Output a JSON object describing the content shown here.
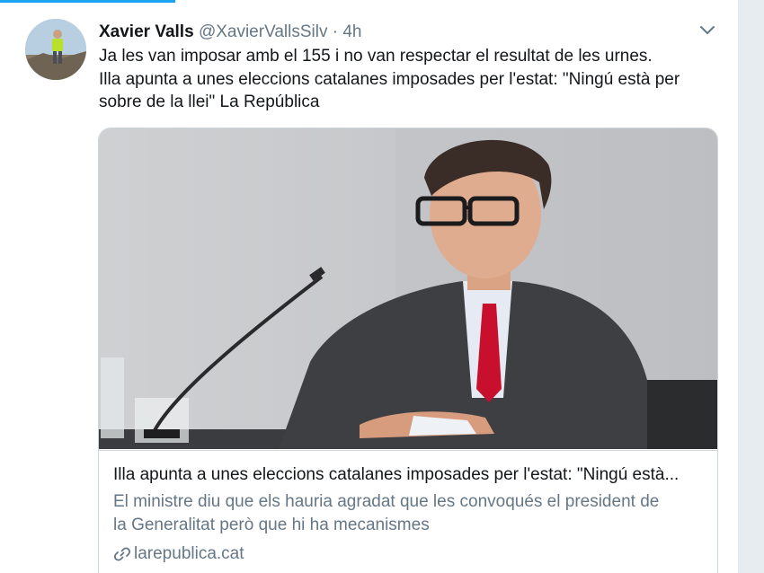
{
  "tweet": {
    "author_name": "Xavier Valls",
    "author_handle": "@XavierVallsSilv",
    "separator": "·",
    "timestamp": "4h",
    "text_lines": [
      "Ja les van imposar amb el 155 i no van respectar el resultat de les urnes.",
      "Illa apunta a unes eleccions catalanes imposades per l'estat: \"Ningú està per",
      "sobre de la llei\" La República"
    ]
  },
  "card": {
    "title": "Illa apunta a unes eleccions catalanes imposades per l'estat: \"Ningú està...",
    "description_lines": [
      "El ministre diu que els hauria agradat que les convoqués el president de",
      "la Generalitat però que hi ha mecanismes"
    ],
    "domain": "larepublica.cat"
  },
  "icons": {
    "caret": "chevron-down-icon",
    "link": "link-icon"
  },
  "colors": {
    "accent": "#1da1f2",
    "secondary_text": "#657786",
    "tie": "#c8102e"
  }
}
